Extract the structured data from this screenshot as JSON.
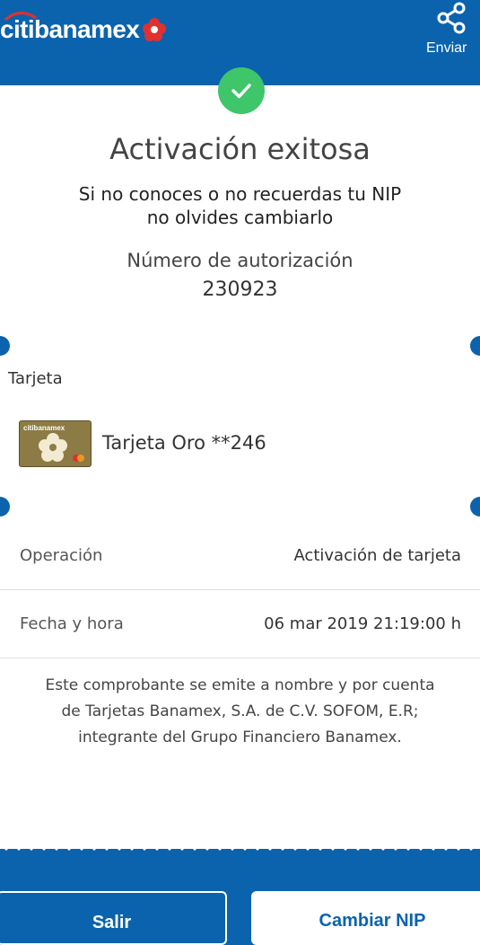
{
  "header": {
    "logo_text": "citibanamex",
    "share_label": "Enviar",
    "share_icon": "share-icon"
  },
  "receipt": {
    "status_icon": "check-icon",
    "title": "Activación exitosa",
    "subtitle_line1": "Si no conoces o no recuerdas tu NIP",
    "subtitle_line2": "no olvides cambiarlo",
    "auth_label": "Número de autorización",
    "auth_number": "230923",
    "card_section_label": "Tarjeta",
    "card_image_brand": "citibanamex",
    "card_name": "Tarjeta Oro **246",
    "details": [
      {
        "label": "Operación",
        "value": "Activación de tarjeta"
      },
      {
        "label": "Fecha y hora",
        "value": "06 mar 2019 21:19:00 h"
      }
    ],
    "disclaimer_line1": "Este comprobante se emite a nombre y por cuenta",
    "disclaimer_line2": "de Tarjetas Banamex, S.A. de C.V. SOFOM, E.R;",
    "disclaimer_line3": "integrante del Grupo Financiero Banamex."
  },
  "actions": {
    "exit_label": "Salir",
    "change_nip_label": "Cambiar NIP"
  },
  "colors": {
    "brand_blue": "#0b63ad",
    "success_green": "#3fc56a",
    "logo_red": "#e0312f",
    "card_gold": "#8c7b44"
  }
}
